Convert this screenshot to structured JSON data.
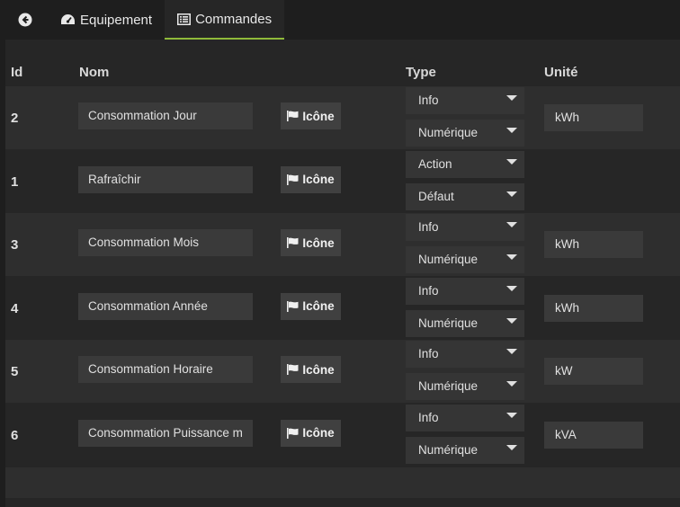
{
  "tabs": {
    "back_icon": "arrow-circle-left-icon",
    "equipement_label": "Equipement",
    "commandes_label": "Commandes"
  },
  "table": {
    "headers": {
      "id": "Id",
      "nom": "Nom",
      "type": "Type",
      "unite": "Unité"
    },
    "icon_button_label": "Icône",
    "rows": [
      {
        "id": "2",
        "name": "Consommation Jour",
        "type": "Info",
        "subtype": "Numérique",
        "unit": "kWh"
      },
      {
        "id": "1",
        "name": "Rafraîchir",
        "type": "Action",
        "subtype": "Défaut",
        "unit": ""
      },
      {
        "id": "3",
        "name": "Consommation Mois",
        "type": "Info",
        "subtype": "Numérique",
        "unit": "kWh"
      },
      {
        "id": "4",
        "name": "Consommation Année",
        "type": "Info",
        "subtype": "Numérique",
        "unit": "kWh"
      },
      {
        "id": "5",
        "name": "Consommation Horaire",
        "type": "Info",
        "subtype": "Numérique",
        "unit": "kW"
      },
      {
        "id": "6",
        "name": "Consommation Puissance m",
        "type": "Info",
        "subtype": "Numérique",
        "unit": "kVA"
      }
    ]
  },
  "colors": {
    "active_tab_underline": "#8fb93a",
    "background": "#1e1e1e",
    "panel": "#262626"
  }
}
